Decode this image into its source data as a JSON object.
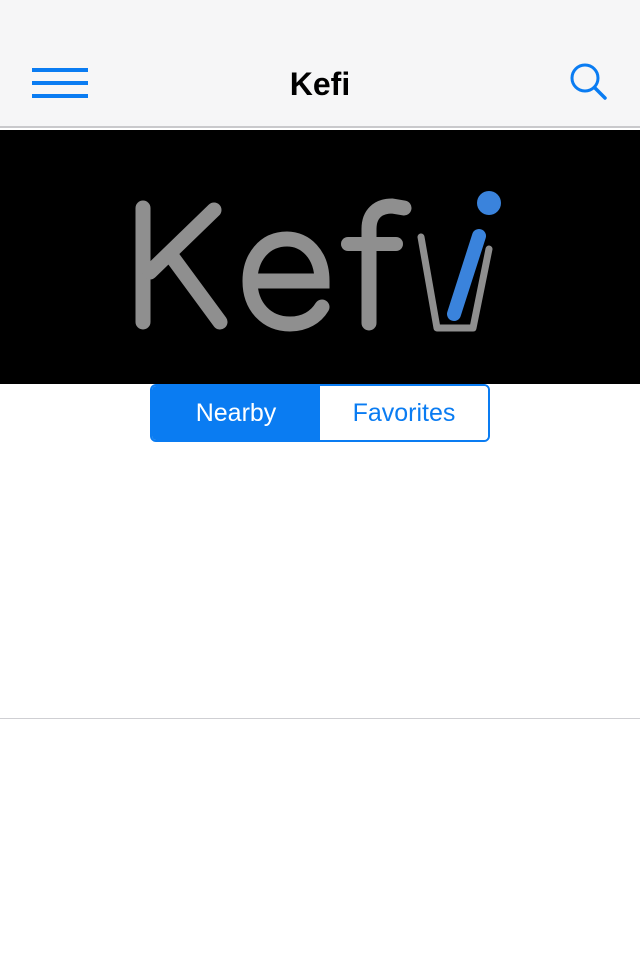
{
  "navbar": {
    "title": "Kefi",
    "menu_icon": "hamburger-menu-icon",
    "search_icon": "search-icon"
  },
  "hero": {
    "logo_text": "Kefi",
    "background_color": "#000000",
    "logo_text_color": "#8f8f8f",
    "logo_accent_color": "#3a83dc"
  },
  "segmented_control": {
    "options": [
      "Nearby",
      "Favorites"
    ],
    "selected": "Nearby"
  },
  "colors": {
    "accent": "#0a7cf2",
    "navbar_bg": "#f6f6f7"
  }
}
